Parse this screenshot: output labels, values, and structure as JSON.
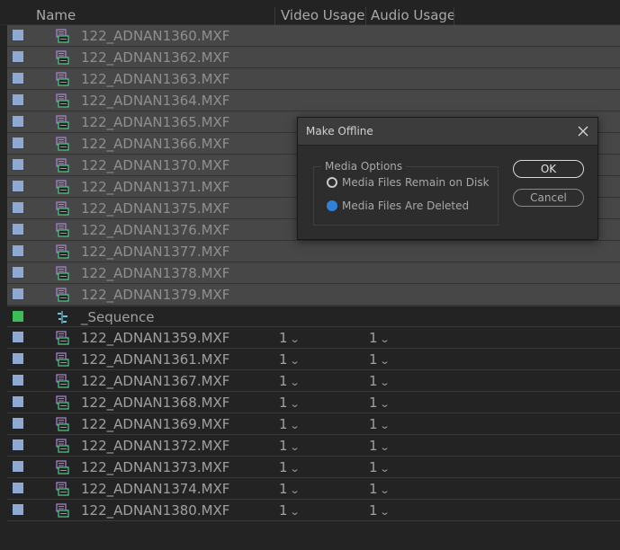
{
  "columns": {
    "name": "Name",
    "video_usage": "Video Usage",
    "audio_usage": "Audio Usage"
  },
  "selected_rows": [
    {
      "name": "122_ADNAN1360.MXF"
    },
    {
      "name": "122_ADNAN1362.MXF"
    },
    {
      "name": "122_ADNAN1363.MXF"
    },
    {
      "name": "122_ADNAN1364.MXF"
    },
    {
      "name": "122_ADNAN1365.MXF"
    },
    {
      "name": "122_ADNAN1366.MXF"
    },
    {
      "name": "122_ADNAN1370.MXF"
    },
    {
      "name": "122_ADNAN1371.MXF"
    },
    {
      "name": "122_ADNAN1375.MXF"
    },
    {
      "name": "122_ADNAN1376.MXF"
    },
    {
      "name": "122_ADNAN1377.MXF"
    },
    {
      "name": "122_ADNAN1378.MXF"
    },
    {
      "name": "122_ADNAN1379.MXF"
    }
  ],
  "sequence_row": {
    "name": "_Sequence",
    "color": "#3dbb55"
  },
  "used_rows": [
    {
      "name": "122_ADNAN1359.MXF",
      "video_usage": "1",
      "audio_usage": "1"
    },
    {
      "name": "122_ADNAN1361.MXF",
      "video_usage": "1",
      "audio_usage": "1"
    },
    {
      "name": "122_ADNAN1367.MXF",
      "video_usage": "1",
      "audio_usage": "1"
    },
    {
      "name": "122_ADNAN1368.MXF",
      "video_usage": "1",
      "audio_usage": "1"
    },
    {
      "name": "122_ADNAN1369.MXF",
      "video_usage": "1",
      "audio_usage": "1"
    },
    {
      "name": "122_ADNAN1372.MXF",
      "video_usage": "1",
      "audio_usage": "1"
    },
    {
      "name": "122_ADNAN1373.MXF",
      "video_usage": "1",
      "audio_usage": "1"
    },
    {
      "name": "122_ADNAN1374.MXF",
      "video_usage": "1",
      "audio_usage": "1"
    },
    {
      "name": "122_ADNAN1380.MXF",
      "video_usage": "1",
      "audio_usage": "1"
    }
  ],
  "clip_label_color": "#8eaad4",
  "dialog": {
    "title": "Make Offline",
    "group_label": "Media Options",
    "option_remain": "Media Files Remain on Disk",
    "option_deleted": "Media Files Are Deleted",
    "selected_option": "option_deleted",
    "ok_label": "OK",
    "cancel_label": "Cancel",
    "accent_color": "#2f82d8"
  },
  "icons": {
    "clip": "video-clip-icon",
    "sequence": "sequence-icon",
    "close": "close-icon",
    "usage_dropdown": "chevron-down-icon"
  }
}
